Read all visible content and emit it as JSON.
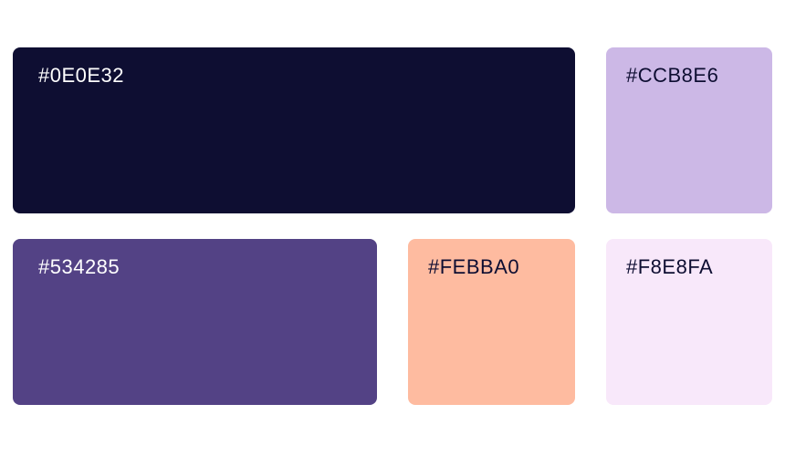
{
  "palette": {
    "swatches": [
      {
        "label": "#0E0E32",
        "color": "#0E0E32",
        "text_color": "#FFFFFF"
      },
      {
        "label": "#CCB8E6",
        "color": "#CCB8E6",
        "text_color": "#0E0E32"
      },
      {
        "label": "#534285",
        "color": "#534285",
        "text_color": "#FFFFFF"
      },
      {
        "label": "#FEBBA0",
        "color": "#FEBBA0",
        "text_color": "#0E0E32"
      },
      {
        "label": "#F8E8FA",
        "color": "#F8E8FA",
        "text_color": "#0E0E32"
      }
    ]
  }
}
